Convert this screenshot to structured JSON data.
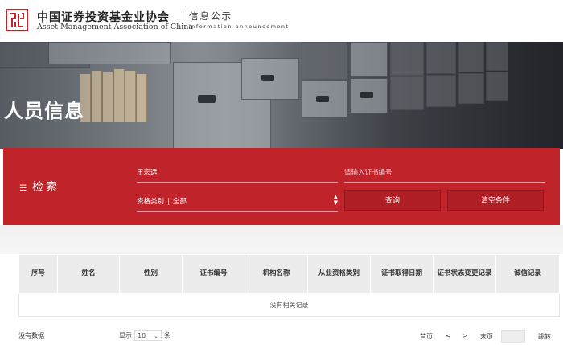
{
  "header": {
    "org_name_cn": "中国证券投资基金业协会",
    "org_name_en": "Asset Management Association of China",
    "section_cn": "信息公示",
    "section_en": "information announcement",
    "brand_color": "#c1232b"
  },
  "banner": {
    "title": "人员信息"
  },
  "search": {
    "label": "检索",
    "name_value": "王宏远",
    "cert_placeholder": "请输入证书编号",
    "category_label": "资格类别",
    "category_value": "全部",
    "search_button": "查询",
    "clear_button": "清空条件"
  },
  "table": {
    "headers": [
      "序号",
      "姓名",
      "性别",
      "证书编号",
      "机构名称",
      "从业资格类别",
      "证书取得日期",
      "证书状态变更记录",
      "诚信记录"
    ],
    "empty_message": "没有相关记录"
  },
  "pagination": {
    "no_data": "没有数据",
    "show_label": "显示",
    "page_size": "10",
    "per_page_unit": "条",
    "first": "首页",
    "prev": "<",
    "next": ">",
    "last": "末页",
    "jump": "跳转"
  }
}
